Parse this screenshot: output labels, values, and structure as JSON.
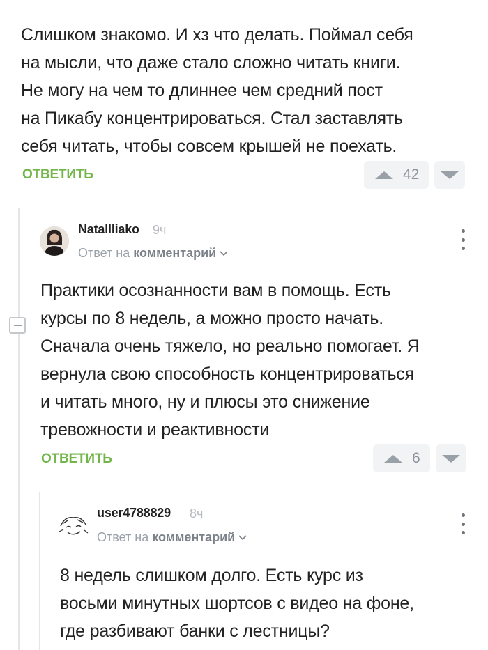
{
  "comment1": {
    "lines": [
      "Слишком знакомо. И хз что делать. Поймал себя",
      "на мысли, что даже стало сложно читать книги.",
      "Не могу на чем то длиннее чем средний пост",
      "на Пикабу концентрироваться. Стал заставлять",
      "себя читать, чтобы совсем крышей не поехать."
    ],
    "reply_label": "ОТВЕТИТЬ",
    "rating": "42"
  },
  "comment2": {
    "author": "Natallliako",
    "time": "9ч",
    "reply_prefix": "Ответ на",
    "reply_target": "комментарий",
    "lines": [
      "Практики осознанности вам в помощь. Есть",
      "курсы по 8 недель, а можно просто начать.",
      "Сначала очень тяжело, но реально помогает. Я",
      "вернула свою способность концентрироваться",
      "и читать много, ну и плюсы это снижение",
      "тревожности и реактивности"
    ],
    "reply_label": "ОТВЕТИТЬ",
    "rating": "6"
  },
  "comment3": {
    "author": "user4788829",
    "time": "8ч",
    "reply_prefix": "Ответ на",
    "reply_target": "комментарий",
    "lines": [
      "8 недель слишком долго. Есть курс из",
      "восьми минутных шортсов с видео на фоне,",
      "где разбивают банки с лестницы?"
    ]
  },
  "colors": {
    "accent": "#72b548",
    "vote_bg": "#f2f3f5",
    "muted": "#9aa0a8"
  },
  "icons": [
    "vote-up-icon",
    "vote-down-icon",
    "collapse-icon",
    "chevron-down-icon",
    "more-vertical-icon"
  ]
}
